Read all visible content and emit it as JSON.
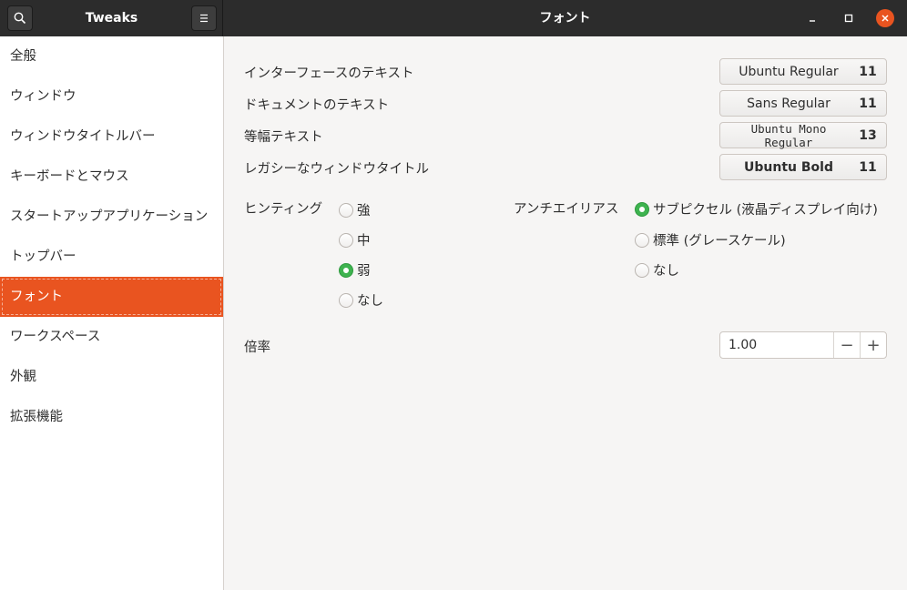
{
  "header": {
    "app_title": "Tweaks",
    "page_title": "フォント",
    "icons": {
      "search": "search-icon",
      "menu": "hamburger-menu-icon",
      "minimize": "minimize-icon",
      "maximize": "maximize-icon",
      "close": "close-icon"
    }
  },
  "sidebar": {
    "items": [
      {
        "label": "全般"
      },
      {
        "label": "ウィンドウ"
      },
      {
        "label": "ウィンドウタイトルバー"
      },
      {
        "label": "キーボードとマウス"
      },
      {
        "label": "スタートアップアプリケーション"
      },
      {
        "label": "トップバー"
      },
      {
        "label": "フォント",
        "active": true
      },
      {
        "label": "ワークスペース"
      },
      {
        "label": "外観"
      },
      {
        "label": "拡張機能"
      }
    ],
    "active_color": "#e95420"
  },
  "fonts": {
    "interface": {
      "label": "インターフェースのテキスト",
      "font": "Ubuntu Regular",
      "size": "11"
    },
    "document": {
      "label": "ドキュメントのテキスト",
      "font": "Sans Regular",
      "size": "11"
    },
    "monospace": {
      "label": "等幅テキスト",
      "font": "Ubuntu Mono Regular",
      "size": "13"
    },
    "legacy_title": {
      "label": "レガシーなウィンドウタイトル",
      "font": "Ubuntu Bold",
      "size": "11"
    }
  },
  "hinting": {
    "label": "ヒンティング",
    "options": [
      "強",
      "中",
      "弱",
      "なし"
    ],
    "selected": "弱"
  },
  "antialiasing": {
    "label": "アンチエイリアス",
    "options": [
      "サブピクセル (液晶ディスプレイ向け)",
      "標準 (グレースケール)",
      "なし"
    ],
    "selected": "サブピクセル (液晶ディスプレイ向け)"
  },
  "scaling": {
    "label": "倍率",
    "value": "1.00",
    "decrement": "−",
    "increment": "+"
  },
  "colors": {
    "accent": "#e95420",
    "radio_selected": "#3eb34f",
    "header": "#2c2c2c"
  }
}
